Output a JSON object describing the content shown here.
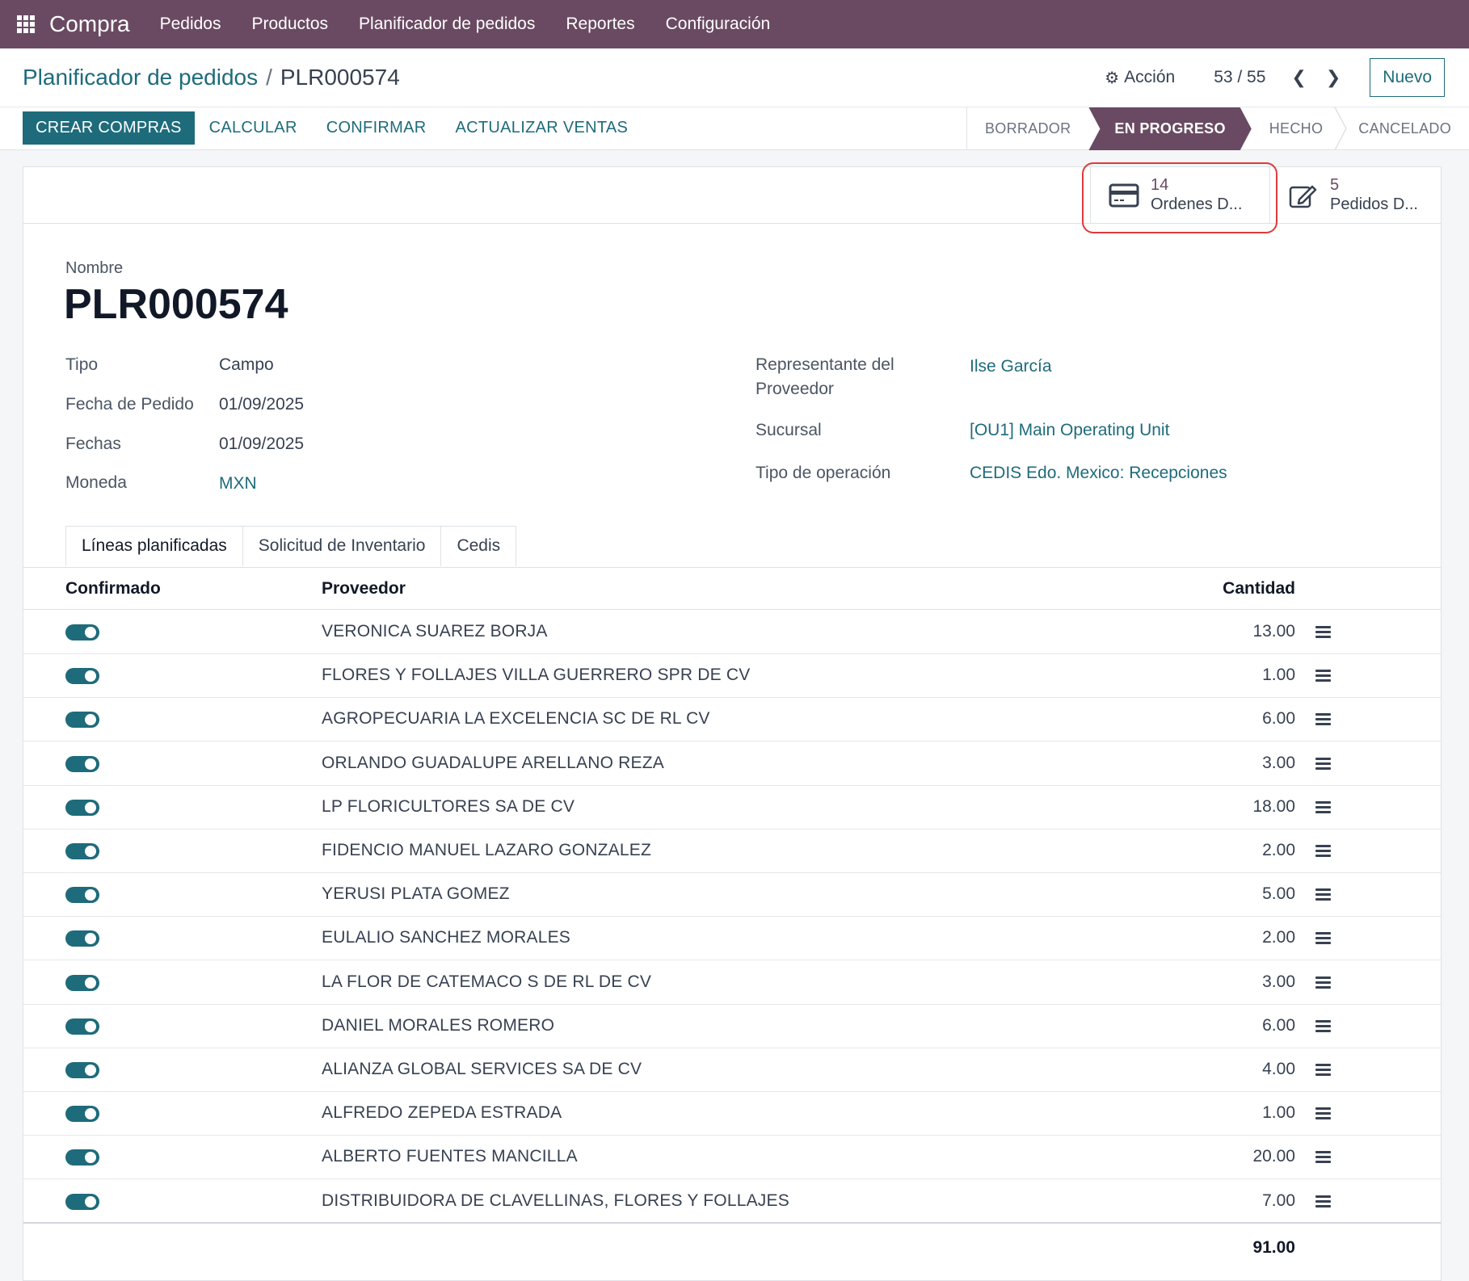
{
  "app": {
    "name": "Compra",
    "nav": [
      "Pedidos",
      "Productos",
      "Planificador de pedidos",
      "Reportes",
      "Configuración"
    ]
  },
  "breadcrumb": {
    "parent": "Planificador de pedidos",
    "separator": "/",
    "current": "PLR000574"
  },
  "header": {
    "action_label": "Acción",
    "pager": "53 / 55",
    "new_label": "Nuevo"
  },
  "buttons": {
    "create": "CREAR COMPRAS",
    "calculate": "CALCULAR",
    "confirm": "CONFIRMAR",
    "update_sales": "ACTUALIZAR VENTAS"
  },
  "stages": [
    "BORRADOR",
    "EN PROGRESO",
    "HECHO",
    "CANCELADO"
  ],
  "active_stage": "EN PROGRESO",
  "smart_buttons": [
    {
      "value": "14",
      "label": "Ordenes D...",
      "icon": "credit-card-icon"
    },
    {
      "value": "5",
      "label": "Pedidos D...",
      "icon": "edit-icon"
    }
  ],
  "form": {
    "name_label": "Nombre",
    "name": "PLR000574",
    "left": [
      {
        "label": "Tipo",
        "value": "Campo"
      },
      {
        "label": "Fecha de Pedido",
        "value": "01/09/2025"
      },
      {
        "label": "Fechas",
        "value": "01/09/2025"
      },
      {
        "label": "Moneda",
        "value": "MXN"
      }
    ],
    "right": [
      {
        "label_line1": "Representante del",
        "label_line2": "Proveedor",
        "value": "Ilse García"
      },
      {
        "label": "Sucursal",
        "value": "[OU1] Main Operating Unit"
      },
      {
        "label": "Tipo de operación",
        "value": "CEDIS Edo. Mexico: Recepciones"
      }
    ]
  },
  "tabs": [
    "Líneas planificadas",
    "Solicitud de Inventario",
    "Cedis"
  ],
  "table": {
    "headers": {
      "confirmed": "Confirmado",
      "supplier": "Proveedor",
      "quantity": "Cantidad"
    },
    "rows": [
      {
        "supplier": "VERONICA SUAREZ BORJA",
        "qty": "13.00"
      },
      {
        "supplier": "FLORES Y FOLLAJES VILLA GUERRERO SPR DE CV",
        "qty": "1.00"
      },
      {
        "supplier": "AGROPECUARIA LA EXCELENCIA SC DE RL CV",
        "qty": "6.00"
      },
      {
        "supplier": "ORLANDO GUADALUPE ARELLANO REZA",
        "qty": "3.00"
      },
      {
        "supplier": "LP FLORICULTORES SA DE CV",
        "qty": "18.00"
      },
      {
        "supplier": "FIDENCIO MANUEL LAZARO GONZALEZ",
        "qty": "2.00"
      },
      {
        "supplier": "YERUSI PLATA GOMEZ",
        "qty": "5.00"
      },
      {
        "supplier": "EULALIO SANCHEZ MORALES",
        "qty": "2.00"
      },
      {
        "supplier": "LA FLOR DE CATEMACO S DE RL DE CV",
        "qty": "3.00"
      },
      {
        "supplier": "DANIEL MORALES ROMERO",
        "qty": "6.00"
      },
      {
        "supplier": "ALIANZA GLOBAL SERVICES SA DE CV",
        "qty": "4.00"
      },
      {
        "supplier": "ALFREDO ZEPEDA ESTRADA",
        "qty": "1.00"
      },
      {
        "supplier": "ALBERTO FUENTES MANCILLA",
        "qty": "20.00"
      },
      {
        "supplier": "DISTRIBUIDORA DE CLAVELLINAS, FLORES Y FOLLAJES",
        "qty": "7.00"
      }
    ],
    "total": "91.00"
  },
  "colors": {
    "brand": "#6a4a62",
    "accent": "#1e6b7b",
    "highlight": "#e03a3a"
  }
}
